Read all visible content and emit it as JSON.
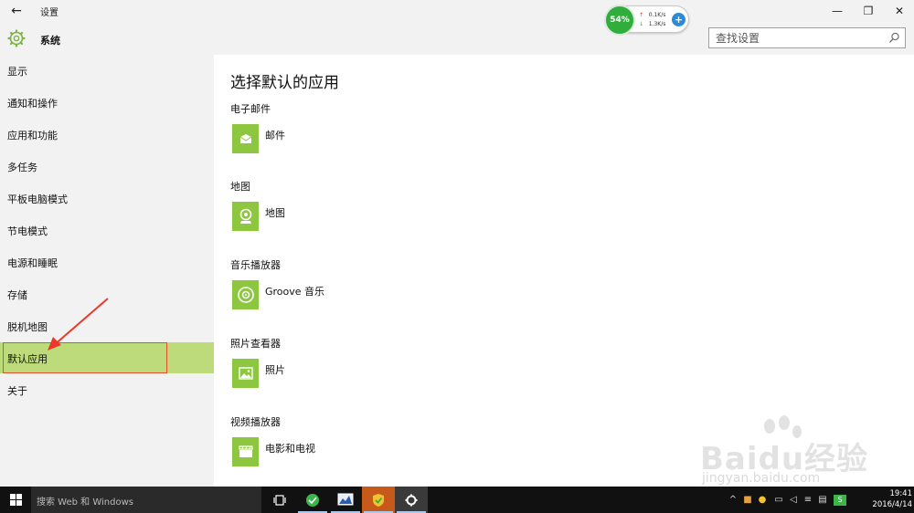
{
  "window": {
    "title": "设置",
    "header_title": "系统",
    "minimize": "—",
    "maximize": "❐",
    "close": "✕",
    "back": "←"
  },
  "search": {
    "placeholder": "查找设置"
  },
  "widget": {
    "percent": "54%",
    "up_speed": "0.1K/s",
    "down_speed": "1.3K/s",
    "plus": "+"
  },
  "sidebar": {
    "items": [
      {
        "label": "显示"
      },
      {
        "label": "通知和操作"
      },
      {
        "label": "应用和功能"
      },
      {
        "label": "多任务"
      },
      {
        "label": "平板电脑模式"
      },
      {
        "label": "节电模式"
      },
      {
        "label": "电源和睡眠"
      },
      {
        "label": "存储"
      },
      {
        "label": "脱机地图"
      },
      {
        "label": "默认应用",
        "selected": true
      },
      {
        "label": "关于"
      }
    ]
  },
  "main": {
    "title": "选择默认的应用",
    "sections": [
      {
        "title": "电子邮件",
        "app": "邮件",
        "icon": "mail-icon"
      },
      {
        "title": "地图",
        "app": "地图",
        "icon": "map-icon"
      },
      {
        "title": "音乐播放器",
        "app": "Groove 音乐",
        "icon": "music-disc-icon"
      },
      {
        "title": "照片查看器",
        "app": "照片",
        "icon": "photo-icon"
      },
      {
        "title": "视频播放器",
        "app": "电影和电视",
        "icon": "film-icon"
      }
    ],
    "accent_color": "#8dc63f"
  },
  "taskbar": {
    "search_text": "搜索 Web 和 Windows",
    "time": "19:41",
    "date": "2016/4/14"
  },
  "watermark": {
    "text": "Baidu经验",
    "url": "jingyan.baidu.com"
  },
  "colors": {
    "selected_bg": "#bddb7a",
    "highlight_outline": "#e8502b",
    "tile_green": "#8dc63f"
  }
}
